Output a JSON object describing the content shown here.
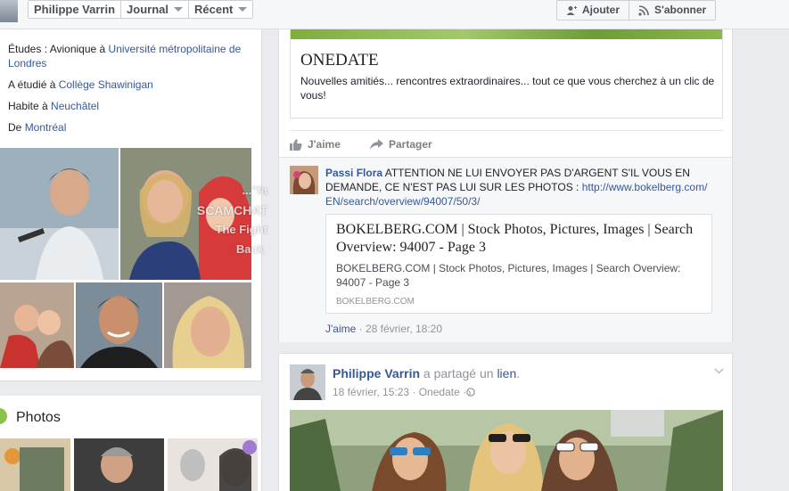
{
  "header": {
    "name_tab": "Philippe Varrin",
    "journal_tab": "Journal",
    "recent_tab": "Récent",
    "add_button": "Ajouter",
    "follow_button": "S'abonner"
  },
  "intro": {
    "studies_prefix": "Études : Avionique à ",
    "studies_link": "Université métropolitaine de Londres",
    "studied_prefix": "A étudié à ",
    "studied_link": "Collège Shawinigan",
    "lives_prefix": "Habite à ",
    "lives_link": "Neuchâtel",
    "from_prefix": "De ",
    "from_link": "Montréal"
  },
  "photos_section": {
    "title": "Photos"
  },
  "post1": {
    "ad_title": "ONEDATE",
    "ad_text": "Nouvelles amitiés... rencontres extraordinaires... tout ce que vous cherchez à un clic de vous!",
    "like": "J'aime",
    "share": "Partager",
    "comment": {
      "author": "Passi Flora",
      "text": " ATTENTION NE LUI ENVOYER PAS D'ARGENT S'IL VOUS EN DEMANDE, CE N'EST PAS LUI SUR LES PHOTOS : ",
      "url": "http://www.bokelberg.com/EN/search/overview/94007/50/3/",
      "link_title": "BOKELBERG.COM | Stock Photos, Pictures, Images | Search Overview: 94007 - Page 3",
      "link_desc": "BOKELBERG.COM | Stock Photos, Pictures, Images | Search Overview: 94007 - Page 3",
      "link_domain": "BOKELBERG.COM",
      "like": "J'aime",
      "time": " · 28 février, 18:20"
    }
  },
  "post2": {
    "author": "Philippe Varrin",
    "shared_text": " a partagé un ",
    "shared_link": "lien",
    "shared_end": ".",
    "meta": "18 février, 15:23 · Onedate · "
  },
  "watermark": {
    "line1": "...\"fa",
    "line2": "SCAMCHAT",
    "line3": "The Fight",
    "line4": "Back"
  },
  "colors": {
    "link": "#365899",
    "background": "#e9ebee",
    "card": "#ffffff",
    "border": "#dddfe2"
  }
}
